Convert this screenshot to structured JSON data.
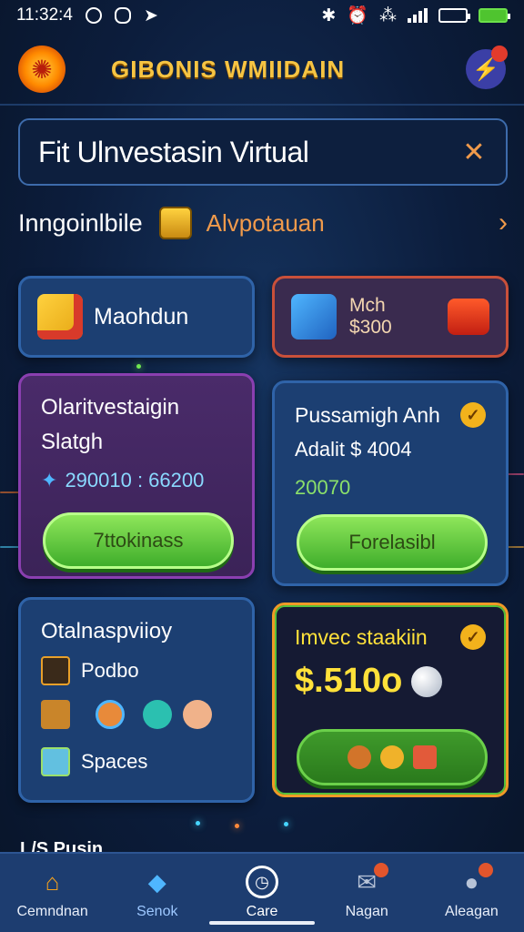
{
  "status_bar": {
    "time": "11:32:4",
    "icons": [
      "record-icon",
      "message-icon",
      "location-arrow-icon",
      "bluetooth-icon",
      "alarm-icon",
      "signal-icon",
      "wifi-icon",
      "battery-icon",
      "charging-battery-icon"
    ]
  },
  "header": {
    "title": "GIBONIS WMIIDAIN",
    "logo_icon": "sun-emblem-icon",
    "action_icon": "lightning-icon"
  },
  "search": {
    "value": "Fit Ulnvestasin Virtual",
    "clear_icon": "close-icon"
  },
  "subheader": {
    "label": "Inngoinlbile",
    "link": "Alvpotauan",
    "chevron_icon": "chevron-right-icon"
  },
  "cards": {
    "c1": {
      "title": "Maohdun"
    },
    "c2": {
      "line1": "Mch",
      "line2": "$300"
    },
    "c3": {
      "title_line1": "Olaritvestaigin",
      "title_line2": "Slatgh",
      "amount": "290010 : 66200",
      "button": "7ttokinass"
    },
    "c4": {
      "title": "Pussamigh Anh",
      "detail": "Adalit $ 4004",
      "amount": "20070",
      "button": "Forelasibl"
    },
    "c5": {
      "title": "Otalnaspviioy",
      "item1": "Podbo",
      "item2": "Spaces"
    },
    "c6": {
      "title": "Imvec staakiin",
      "amount": "$.510o"
    }
  },
  "partial_footer_text": "L/S Pusin",
  "nav": [
    {
      "label": "Cemndnan",
      "icon": "home-icon"
    },
    {
      "label": "Senok",
      "icon": "cube-icon"
    },
    {
      "label": "Care",
      "icon": "clock-icon"
    },
    {
      "label": "Nagan",
      "icon": "mail-icon"
    },
    {
      "label": "Aleagan",
      "icon": "user-icon"
    }
  ],
  "colors": {
    "accent_orange": "#f09a4b",
    "gold": "#f6c443",
    "green_button": "#3fae2b",
    "card_blue": "#1c3f72"
  }
}
